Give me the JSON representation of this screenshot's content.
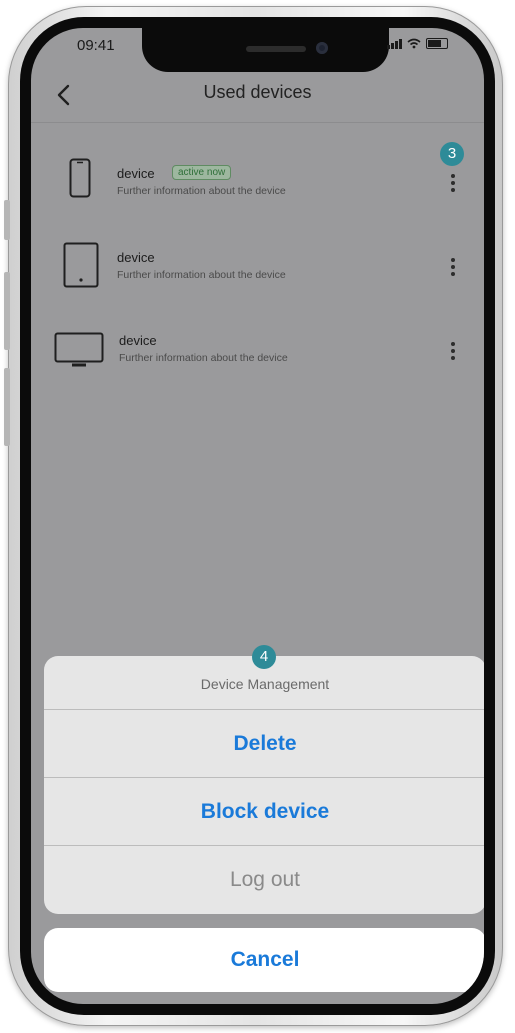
{
  "status_bar": {
    "time": "09:41"
  },
  "header": {
    "title": "Used devices"
  },
  "devices": [
    {
      "name": "device",
      "badge": "active now",
      "description": "Further information about the device",
      "icon": "smartphone-icon"
    },
    {
      "name": "device",
      "description": "Further information about the device",
      "icon": "tablet-icon"
    },
    {
      "name": "device",
      "description": "Further information about the device",
      "icon": "monitor-icon"
    }
  ],
  "markers": {
    "device_menu": "3",
    "action_sheet": "4"
  },
  "action_sheet": {
    "title": "Device Management",
    "delete_label": "Delete",
    "block_label": "Block device",
    "logout_label": "Log out",
    "cancel_label": "Cancel"
  },
  "colors": {
    "accent": "#1a7ad9",
    "disabled": "#8a8a8a",
    "marker": "#2e8b98",
    "badge_text": "#2f6f39",
    "dim_overlay": "#9a9a9c"
  }
}
